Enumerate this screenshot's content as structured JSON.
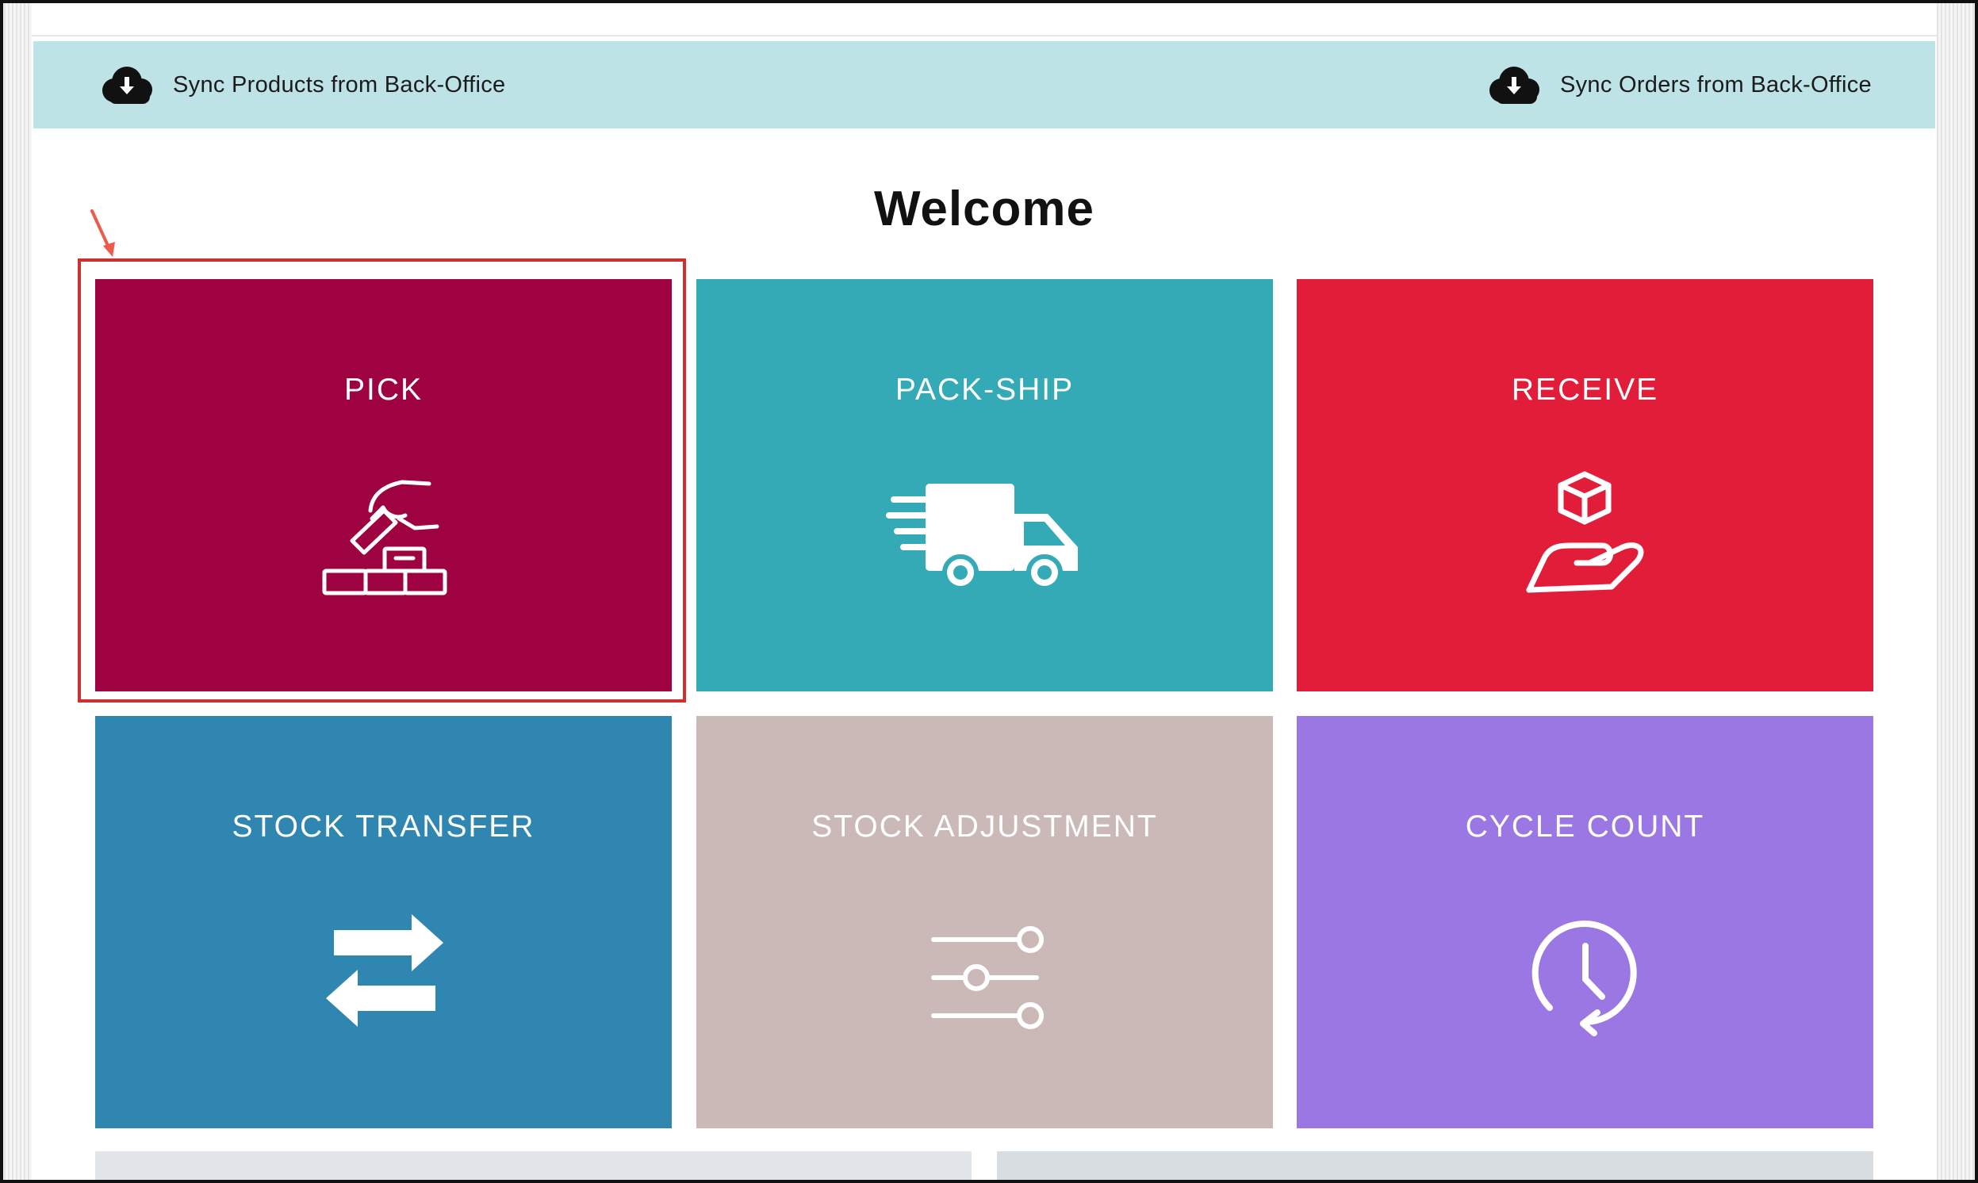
{
  "sync_bar": {
    "products_label": "Sync Products from Back-Office",
    "orders_label": "Sync Orders from Back-Office",
    "icon": "cloud-download-icon"
  },
  "welcome": {
    "title": "Welcome"
  },
  "tiles": [
    {
      "label": "PICK",
      "color": "#9e0240",
      "icon": "pick-hand-boxes-icon"
    },
    {
      "label": "PACK-SHIP",
      "color": "#34aab6",
      "icon": "delivery-truck-icon"
    },
    {
      "label": "RECEIVE",
      "color": "#e21d39",
      "icon": "hand-box-icon"
    },
    {
      "label": "STOCK TRANSFER",
      "color": "#2f87b1",
      "icon": "transfer-arrows-icon"
    },
    {
      "label": "STOCK ADJUSTMENT",
      "color": "#cbb9b8",
      "icon": "sliders-icon"
    },
    {
      "label": "CYCLE COUNT",
      "color": "#9a77e2",
      "icon": "clock-history-icon"
    }
  ],
  "annotation": {
    "highlight_color": "#d12f2f",
    "highlighted_tile": "PICK"
  }
}
